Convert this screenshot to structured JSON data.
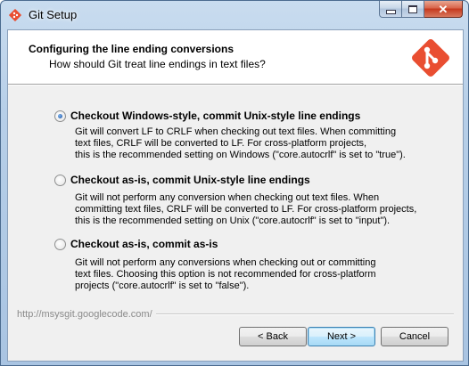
{
  "window": {
    "title": "Git Setup"
  },
  "header": {
    "title": "Configuring the line ending conversions",
    "subtitle": "How should Git treat line endings in text files?"
  },
  "options": [
    {
      "label": "Checkout Windows-style, commit Unix-style line endings",
      "description": "Git will convert LF to CRLF when checking out text files. When committing\ntext files, CRLF will be converted to LF. For cross-platform projects,\nthis is the recommended setting on Windows (\"core.autocrlf\" is set to \"true\").",
      "selected": true
    },
    {
      "label": "Checkout as-is, commit Unix-style line endings",
      "description": "Git will not perform any conversion when checking out text files. When\ncommitting text files, CRLF will be converted to LF. For cross-platform projects,\nthis is the recommended setting on Unix (\"core.autocrlf\" is set to \"input\").",
      "selected": false
    },
    {
      "label": "Checkout as-is, commit as-is",
      "description": "Git will not perform any conversions when checking out or committing\ntext files. Choosing this option is not recommended for cross-platform\nprojects (\"core.autocrlf\" is set to \"false\").",
      "selected": false
    }
  ],
  "footer": {
    "url": "http://msysgit.googlecode.com/"
  },
  "buttons": {
    "back": "< Back",
    "next": "Next >",
    "cancel": "Cancel"
  },
  "colors": {
    "git_logo": "#e94e31",
    "selected_radio": "#1b4f9e"
  }
}
